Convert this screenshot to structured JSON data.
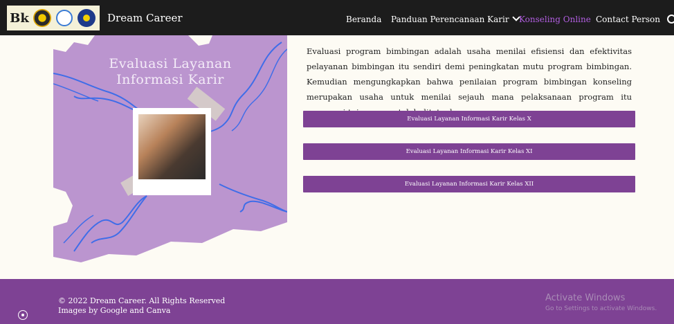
{
  "navbar": {
    "brand": "Dream Career",
    "logo_text": "Bk",
    "items": [
      {
        "label": "Beranda"
      },
      {
        "label": "Panduan Perencanaan Karir"
      },
      {
        "label": "Konseling Online"
      },
      {
        "label": "Contact Person"
      }
    ],
    "active_color": "#b15ee0"
  },
  "poster": {
    "title_line1": "Evaluasi Layanan",
    "title_line2": "Informasi Karir",
    "background": "#bb95cf",
    "scribble_color": "#3f6de8"
  },
  "main": {
    "description": "Evaluasi program bimbingan adalah usaha menilai efisiensi dan efektivitas pelayanan bimbingan itu sendiri demi peningkatan mutu program bimbingan. Kemudian mengungkapkan bahwa penilaian program bimbingan konseling merupakan usaha untuk menilai sejauh mana pelaksanaan program itu mencapai tujuan yang telah ditetapkan.",
    "buttons": [
      {
        "label": "Evaluasi Layanan Informasi Karir Kelas X"
      },
      {
        "label": "Evaluasi Layanan Informasi Karir Kelas XI"
      },
      {
        "label": "Evaluasi Layanan Informasi Karir Kelas XII"
      }
    ],
    "button_color": "#7e4294"
  },
  "footer": {
    "copyright": "© 2022 Dream Career. All Rights Reserved",
    "credits": "Images by Google and Canva",
    "watermark_title": "Activate Windows",
    "watermark_sub": "Go to Settings to activate Windows."
  }
}
